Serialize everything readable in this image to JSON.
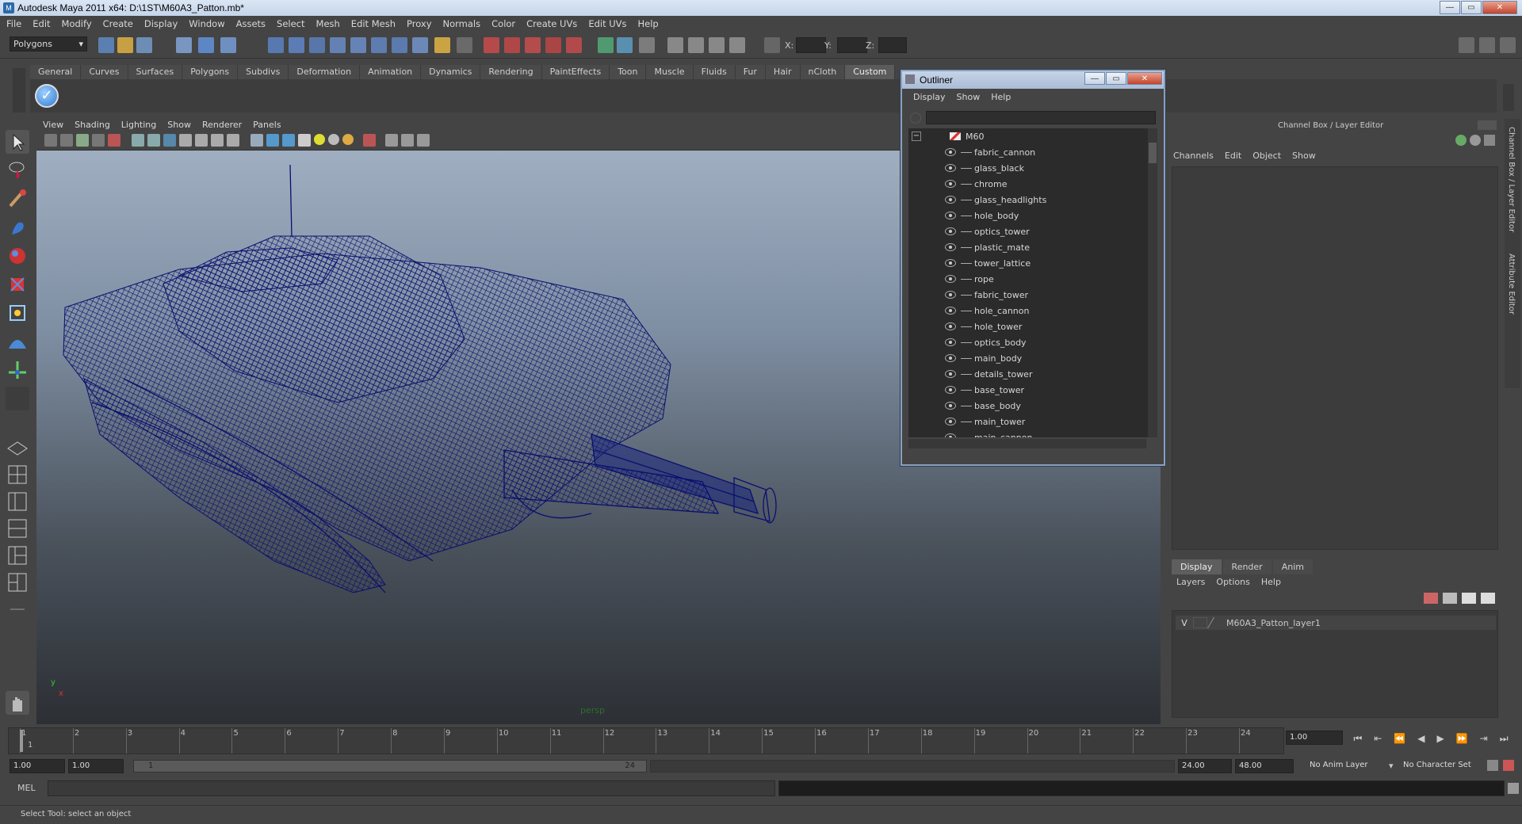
{
  "window": {
    "title": "Autodesk Maya 2011 x64: D:\\1ST\\M60A3_Patton.mb*",
    "minimize": "—",
    "maximize": "▭",
    "close": "✕"
  },
  "menubar": [
    "File",
    "Edit",
    "Modify",
    "Create",
    "Display",
    "Window",
    "Assets",
    "Select",
    "Mesh",
    "Edit Mesh",
    "Proxy",
    "Normals",
    "Color",
    "Create UVs",
    "Edit UVs",
    "Help"
  ],
  "toolbar": {
    "mode_selector": "Polygons",
    "x_label": "X:",
    "y_label": "Y:",
    "z_label": "Z:"
  },
  "shelf": {
    "tabs": [
      "General",
      "Curves",
      "Surfaces",
      "Polygons",
      "Subdivs",
      "Deformation",
      "Animation",
      "Dynamics",
      "Rendering",
      "PaintEffects",
      "Toon",
      "Muscle",
      "Fluids",
      "Fur",
      "Hair",
      "nCloth",
      "Custom"
    ],
    "active_tab": "Custom"
  },
  "viewport": {
    "menu": [
      "View",
      "Shading",
      "Lighting",
      "Show",
      "Renderer",
      "Panels"
    ],
    "camera_label": "persp",
    "axis_y": "y",
    "axis_x": "x"
  },
  "outliner": {
    "title": "Outliner",
    "menu": [
      "Display",
      "Show",
      "Help"
    ],
    "root": "M60",
    "expander": "−",
    "items": [
      "fabric_cannon",
      "glass_black",
      "chrome",
      "glass_headlights",
      "hole_body",
      "optics_tower",
      "plastic_mate",
      "tower_lattice",
      "rope",
      "fabric_tower",
      "hole_cannon",
      "hole_tower",
      "optics_body",
      "main_body",
      "details_tower",
      "base_tower",
      "base_body",
      "main_tower",
      "main_cannon"
    ]
  },
  "channel_box": {
    "title": "Channel Box / Layer Editor",
    "menu": [
      "Channels",
      "Edit",
      "Object",
      "Show"
    ],
    "layer_tabs": [
      "Display",
      "Render",
      "Anim"
    ],
    "active_layer_tab": "Display",
    "layer_menu": [
      "Layers",
      "Options",
      "Help"
    ],
    "layer_visibility": "V",
    "layer_name": "M60A3_Patton_layer1"
  },
  "side_tabs": [
    "Channel Box / Layer Editor",
    "Attribute Editor"
  ],
  "timeline": {
    "frames": [
      "1",
      "2",
      "3",
      "4",
      "5",
      "6",
      "7",
      "8",
      "9",
      "10",
      "11",
      "12",
      "13",
      "14",
      "15",
      "16",
      "17",
      "18",
      "19",
      "20",
      "21",
      "22",
      "23",
      "24"
    ],
    "current_frame": "1",
    "current_time": "1.00",
    "playback_icons": [
      "⏮",
      "⇤",
      "⏪",
      "◀",
      "▶",
      "⏩",
      "⇥",
      "⏭"
    ]
  },
  "range": {
    "start": "1.00",
    "playback_start": "1.00",
    "slider_start": "1",
    "slider_end": "24",
    "playback_end": "24.00",
    "end": "48.00",
    "anim_layer": "No Anim Layer",
    "character_set": "No Character Set"
  },
  "command_line": {
    "label": "MEL"
  },
  "status": {
    "help_text": "Select Tool: select an object"
  },
  "colors": {
    "wireframe": "#0a0f6e",
    "viewport_top": "#a5b4c6",
    "viewport_bottom": "#2c2f34"
  }
}
